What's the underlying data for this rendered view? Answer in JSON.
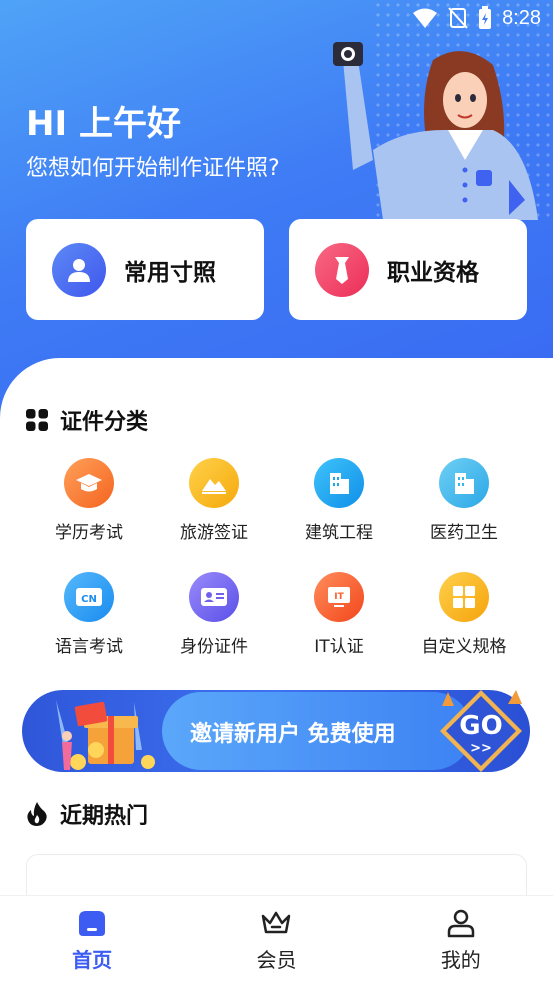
{
  "status_bar": {
    "time": "8:28",
    "icons": [
      "wifi-icon",
      "no-sim-icon",
      "battery-charging-icon"
    ]
  },
  "header": {
    "greeting": "HI 上午好",
    "subtitle": "您想如何开始制作证件照?"
  },
  "quick_actions": [
    {
      "label": "常用寸照",
      "icon": "user-icon",
      "color": "#3f63f0"
    },
    {
      "label": "职业资格",
      "icon": "tie-icon",
      "color": "#f0355f"
    }
  ],
  "categories": {
    "title": "证件分类",
    "icon": "grid-icon",
    "items": [
      {
        "label": "学历考试",
        "icon": "graduation-cap-icon",
        "color": "#f7782b"
      },
      {
        "label": "旅游签证",
        "icon": "mountain-icon",
        "color": "#f7b813"
      },
      {
        "label": "建筑工程",
        "icon": "building-icon",
        "color": "#1aa5f0"
      },
      {
        "label": "医药卫生",
        "icon": "hospital-icon",
        "color": "#36b6ee"
      },
      {
        "label": "语言考试",
        "icon": "cn-icon",
        "color": "#2aa0f5"
      },
      {
        "label": "身份证件",
        "icon": "id-card-icon",
        "color": "#6f61ee"
      },
      {
        "label": "IT认证",
        "icon": "it-icon",
        "color": "#f7602b"
      },
      {
        "label": "自定义规格",
        "icon": "layout-icon",
        "color": "#f7b313"
      }
    ]
  },
  "banner": {
    "text": "邀请新用户 免费使用",
    "go": "GO",
    "arrows": ">>"
  },
  "recent": {
    "title": "近期热门",
    "icon": "flame-icon"
  },
  "tabbar": {
    "items": [
      {
        "label": "首页",
        "icon": "home-icon",
        "active": true
      },
      {
        "label": "会员",
        "icon": "crown-icon",
        "active": false
      },
      {
        "label": "我的",
        "icon": "profile-icon",
        "active": false
      }
    ]
  },
  "colors": {
    "primary": "#3c5cf2",
    "hero_start": "#4fa3f7",
    "hero_end": "#3868f2"
  }
}
